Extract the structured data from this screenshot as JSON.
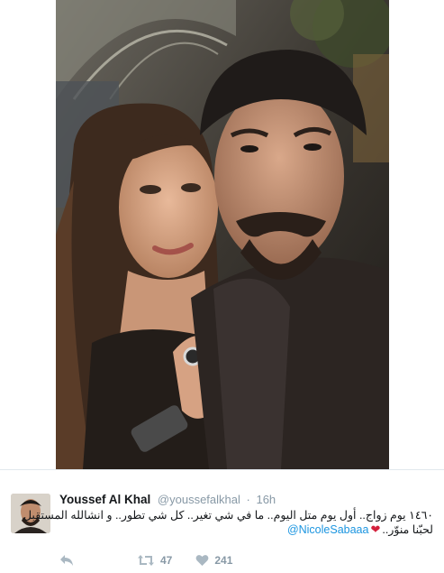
{
  "tweet": {
    "display_name": "Youssef Al Khal",
    "handle": "@youssefalkhal",
    "separator": "·",
    "time": "16h",
    "text_line_1": "١٤٦٠ يوم زواج.. أول يوم متل اليوم.. ما في شي تغير.. كل شي تطور.. و انشالله المستقبل",
    "text_line_2_prefix": "لحبّنا منوّر..",
    "heart": "❤",
    "mention": "@NicoleSabaaa",
    "retweet_count": "47",
    "like_count": "241"
  },
  "icons": {
    "reply": "reply-icon",
    "retweet": "retweet-icon",
    "like": "heart-icon"
  },
  "colors": {
    "link": "#1b95e0",
    "heart": "#d4203c",
    "muted": "#8899a6",
    "action_icon": "#aab8c2"
  }
}
